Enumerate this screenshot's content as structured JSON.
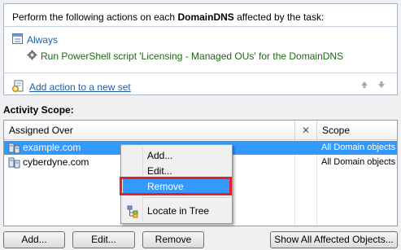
{
  "actions": {
    "header_prefix": "Perform the following actions on each ",
    "header_object": "DomainDNS",
    "header_suffix": " affected by the task:",
    "condition_label": "Always",
    "action_text": "Run PowerShell script 'Licensing - Managed OUs' for the DomainDNS",
    "add_set_label": "Add action to a new set"
  },
  "activity_scope": {
    "title": "Activity Scope:",
    "columns": {
      "assigned_over": "Assigned Over",
      "exclude": "✕",
      "scope": "Scope"
    },
    "rows": [
      {
        "name": "example.com",
        "scope": "All Domain objects",
        "selected": true
      },
      {
        "name": "cyberdyne.com",
        "scope": "All Domain objects",
        "selected": false
      }
    ]
  },
  "context_menu": {
    "items": [
      {
        "label": "Add..."
      },
      {
        "label": "Edit..."
      },
      {
        "label": "Remove"
      },
      {
        "label": "Locate in Tree"
      }
    ]
  },
  "buttons": {
    "add": "Add...",
    "edit": "Edit...",
    "remove": "Remove",
    "show_all": "Show All Affected Objects..."
  },
  "icons": {
    "condition": "condition-list-icon",
    "action": "gear-script-icon",
    "add_set": "add-action-set-icon",
    "move_up": "move-up-icon",
    "move_down": "move-down-icon",
    "domain": "domain-icon",
    "locate": "locate-in-tree-icon"
  },
  "colors": {
    "link": "#1a5fb4",
    "action_text": "#1e6a14",
    "selection": "#3399ff",
    "highlight_box": "#e0202a"
  }
}
